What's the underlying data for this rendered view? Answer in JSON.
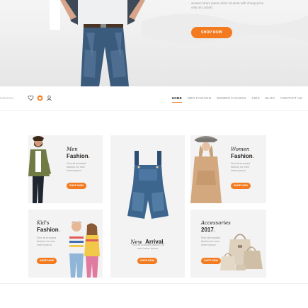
{
  "hero": {
    "text": "women lorem ipsum dolor sit amet with cheap price only on LaziAD",
    "shop_now": "SHOP NOW"
  },
  "nav": {
    "left_text": "Interstore",
    "menu": [
      {
        "label": "HOME",
        "active": true
      },
      {
        "label": "MEN FASHION",
        "active": false
      },
      {
        "label": "WOMEN FASHION",
        "active": false
      },
      {
        "label": "KIDS",
        "active": false
      },
      {
        "label": "BLOG",
        "active": false
      },
      {
        "label": "CONTACT US",
        "active": false
      }
    ]
  },
  "cards": {
    "men": {
      "script": "Men",
      "bold": "Fashion",
      "desc": "Find all branded fashion for men lorem ipsum.",
      "button": "SHOP NOW"
    },
    "new_arrival": {
      "script": "New",
      "bold": "Arrival",
      "desc": "Find all branded fashion for men lorem ipsum.",
      "button": "SHOP NOW"
    },
    "women": {
      "script": "Women",
      "bold": "Fashion",
      "desc": "Find all branded fashion for men lorem ipsum.",
      "button": "SHOP NOW"
    },
    "kids": {
      "script": "Kid's",
      "bold": "Fashion",
      "desc": "Find all branded fashion for men lorem ipsum.",
      "button": "SHOP NOW"
    },
    "accessories": {
      "script": "Accessories",
      "bold": "2017",
      "desc": "Find all branded fashion for men lorem ipsum.",
      "button": "SHOP NOW"
    }
  },
  "colors": {
    "accent": "#f47a1f",
    "card_bg": "#f3f3f3"
  }
}
